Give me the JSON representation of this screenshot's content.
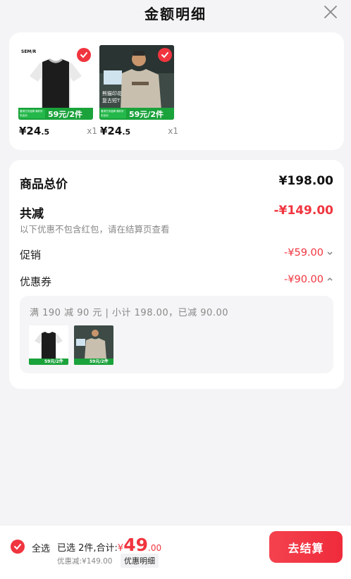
{
  "header": {
    "title": "金额明细"
  },
  "products": [
    {
      "brand": "SEM/R",
      "promo_small": "要求打折品牌 满件折扣活动",
      "promo": "59元/2件",
      "price_int": "¥24",
      "price_dec": ".5",
      "qty": "x1"
    },
    {
      "overlay": "熊猫印花 复古短T",
      "promo_small": "要求打折品牌 满件折扣活动",
      "promo": "59元/2件",
      "price_int": "¥24",
      "price_dec": ".5",
      "qty": "x1"
    }
  ],
  "summary": {
    "total_label": "商品总价",
    "total_value": "¥198.00",
    "reduce_label": "共减",
    "reduce_value": "-¥149.00",
    "note": "以下优惠不包含红包，请在结算页查看",
    "promo_label": "促销",
    "promo_value": "-¥59.00",
    "coupon_label": "优惠券",
    "coupon_value": "-¥90.00",
    "coupon_detail": "满 190 减 90 元 | 小计 198.00，已减 90.00"
  },
  "mini_products": [
    {
      "promo": "59元/2件"
    },
    {
      "promo": "59元/2件"
    }
  ],
  "bottom": {
    "all_label": "全选",
    "selected_text": "已选 2件,合计:",
    "yen": "¥",
    "amount_int": "49",
    "amount_dec": ".00",
    "discount_text": "优惠减:¥149.00",
    "detail_label": "优惠明细",
    "checkout_label": "去结算"
  },
  "colors": {
    "accent": "#f0353f",
    "promo_green": "#1aa23b"
  }
}
